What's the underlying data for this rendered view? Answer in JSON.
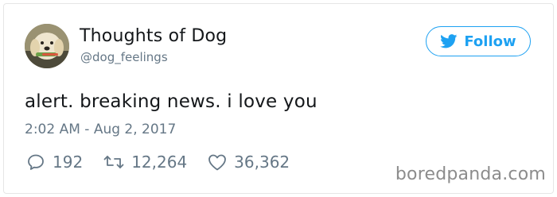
{
  "account": {
    "display_name": "Thoughts of Dog",
    "handle": "@dog_feelings",
    "avatar_icon": "dog-avatar"
  },
  "follow": {
    "label": "Follow",
    "icon": "twitter-bird-icon",
    "color": "#1da1f2"
  },
  "tweet": {
    "text": "alert. breaking news. i love you",
    "timestamp": "2:02 AM - Aug 2, 2017"
  },
  "actions": {
    "replies": "192",
    "retweets": "12,264",
    "likes": "36,362"
  },
  "watermark": "boredpanda.com"
}
